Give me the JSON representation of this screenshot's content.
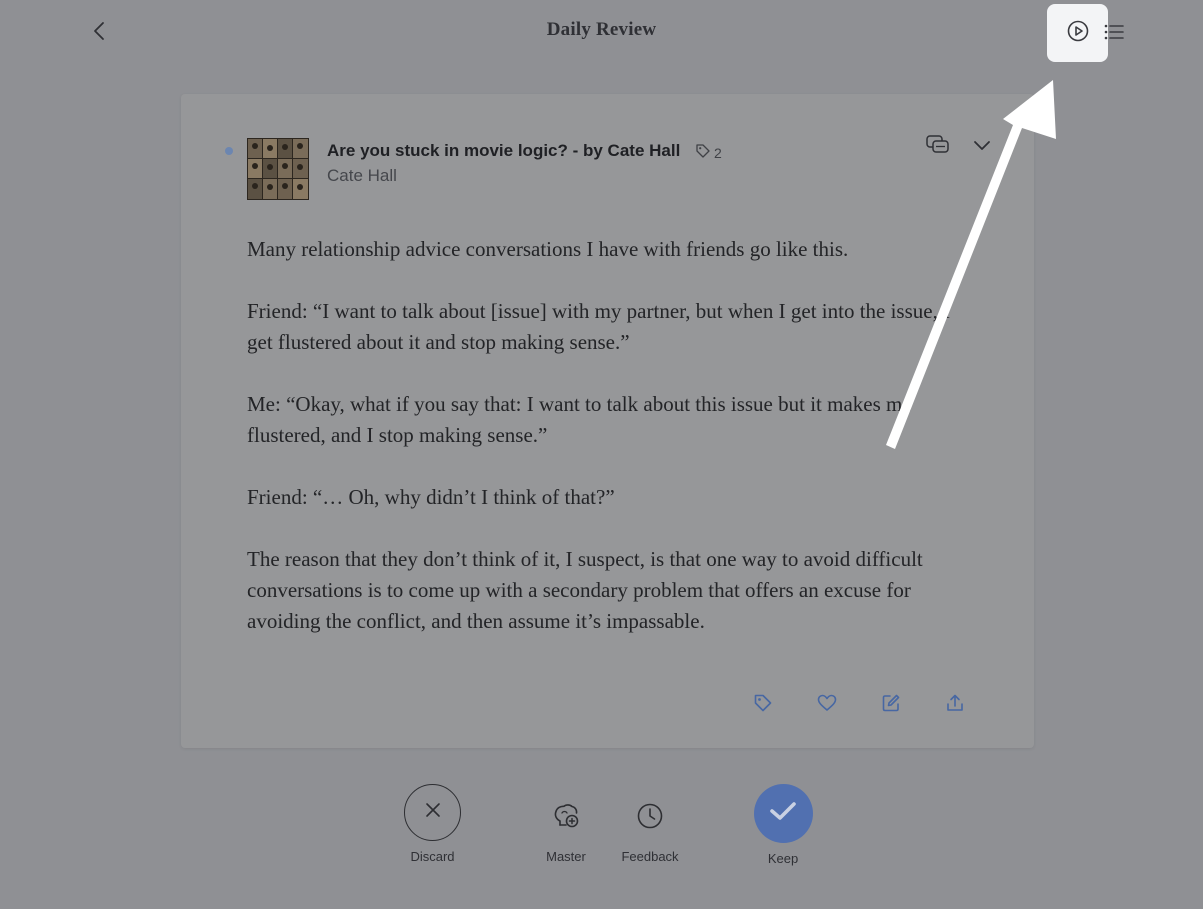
{
  "header": {
    "title": "Daily Review",
    "back_icon": "chevron-left-icon",
    "play_icon": "play-circle-icon",
    "list_icon": "list-icon"
  },
  "document": {
    "title": "Are you stuck in movie logic? - by Cate Hall",
    "author": "Cate Hall",
    "tag_count": "2",
    "paragraphs": [
      "Many relationship advice conversations I have with friends go like this.",
      "Friend: “I want to talk about [issue] with my partner, but when I get into the issue, I get flustered about it and stop making sense.”",
      "Me: “Okay, what if you say that: I want to talk about this issue but it makes me flustered, and I stop making sense.”",
      "Friend: “… Oh, why didn’t I think of that?”",
      "The reason that they don’t think of it, I suspect, is that one way to avoid difficult conversations is to come up with a secondary problem that offers an excuse for avoiding the conflict, and then assume it’s impassable."
    ]
  },
  "card_actions": {
    "tag_icon": "tag-icon",
    "like_icon": "heart-icon",
    "edit_icon": "edit-icon",
    "share_icon": "share-icon"
  },
  "bottom_actions": {
    "discard": "Discard",
    "master": "Master",
    "feedback": "Feedback",
    "keep": "Keep"
  },
  "colors": {
    "background": "#8f9094",
    "card": "#969799",
    "accent": "#5170b0",
    "highlight": "#f3f4f6",
    "unread_dot": "#6c86b0"
  }
}
